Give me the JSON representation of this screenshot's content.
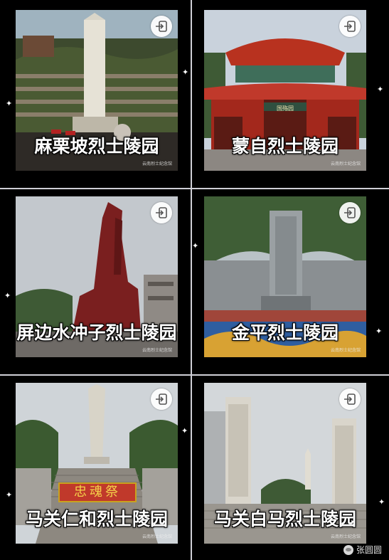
{
  "tiles": [
    {
      "caption": "麻栗坡烈士陵园",
      "watermark": "云南烈士纪念馆",
      "icon": "exit-icon"
    },
    {
      "caption": "蒙自烈士陵园",
      "watermark": "云南烈士纪念馆",
      "icon": "exit-icon"
    },
    {
      "caption": "屏边水冲子烈士陵园",
      "watermark": "云南烈士纪念馆",
      "icon": "exit-icon"
    },
    {
      "caption": "金平烈士陵园",
      "watermark": "云南烈士纪念馆",
      "icon": "exit-icon"
    },
    {
      "caption": "马关仁和烈士陵园",
      "watermark": "云南烈士纪念馆",
      "icon": "exit-icon"
    },
    {
      "caption": "马关白马烈士陵园",
      "watermark": "云南烈士纪念馆",
      "icon": "exit-icon"
    }
  ],
  "signs": {
    "gate_plaque": "国殇园",
    "banner": "忠魂祭"
  },
  "footer": {
    "author": "张圆圆",
    "icon": "wechat-icon"
  },
  "colors": {
    "background": "#000000",
    "divider": "#cfcfd6",
    "caption": "#ffffff"
  }
}
